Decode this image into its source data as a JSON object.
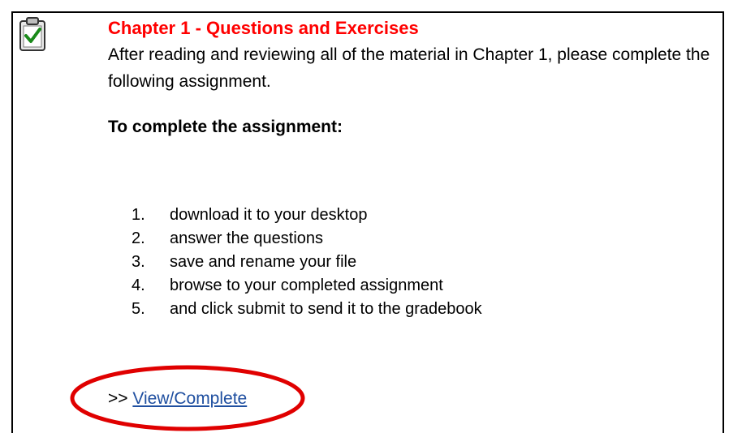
{
  "assignment": {
    "icon": "clipboard-check-icon",
    "title": "Chapter 1 - Questions and Exercises",
    "title_color": "#ff0000",
    "intro": "After reading and reviewing all of the material in Chapter 1, please complete the following assignment.",
    "subheading": "To complete the assignment:",
    "steps": [
      {
        "num": "1.",
        "text": "download it to your desktop"
      },
      {
        "num": "2.",
        "text": "answer the questions"
      },
      {
        "num": "3.",
        "text": "save and rename your file"
      },
      {
        "num": "4.",
        "text": "browse to your completed assignment"
      },
      {
        "num": "5.",
        "text": "and click submit to send it to the gradebook"
      }
    ],
    "link_prefix": ">>",
    "link_label": "View/Complete",
    "link_color": "#1f4fa0",
    "highlight_color": "#e00000"
  }
}
